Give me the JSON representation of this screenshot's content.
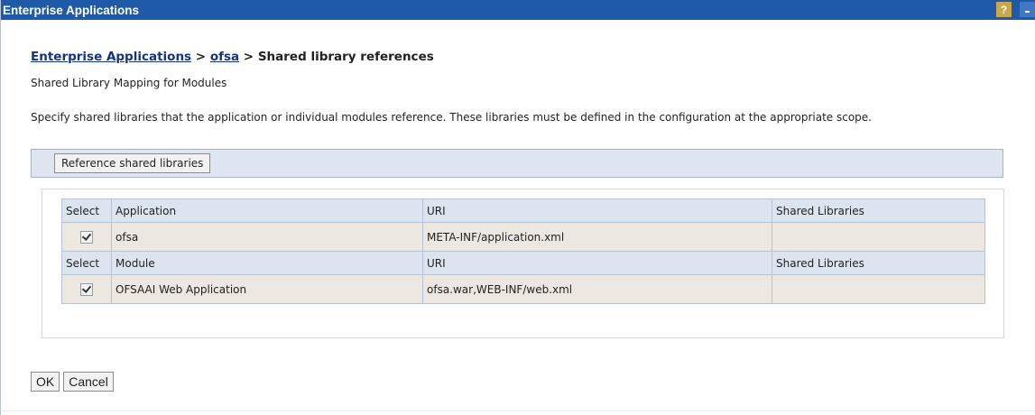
{
  "window": {
    "title": "Enterprise Applications",
    "help_glyph": "?"
  },
  "breadcrumb": {
    "root": "Enterprise Applications",
    "sep1": " > ",
    "app": "ofsa",
    "sep2": " > ",
    "current": "Shared library references"
  },
  "subtitle": "Shared Library Mapping for Modules",
  "description": "Specify shared libraries that the application or individual modules reference. These libraries must be defined in the configuration at the appropriate scope.",
  "reference_button": "Reference shared libraries",
  "table": {
    "app_header": {
      "select": "Select",
      "name": "Application",
      "uri": "URI",
      "libs": "Shared Libraries"
    },
    "app_row": {
      "checked": true,
      "name": "ofsa",
      "uri": "META-INF/application.xml",
      "libs": ""
    },
    "module_header": {
      "select": "Select",
      "name": "Module",
      "uri": "URI",
      "libs": "Shared Libraries"
    },
    "module_row": {
      "checked": true,
      "name": "OFSAAI Web Application",
      "uri": "ofsa.war,WEB-INF/web.xml",
      "libs": ""
    }
  },
  "actions": {
    "ok": "OK",
    "cancel": "Cancel"
  },
  "colors": {
    "titlebar": "#1f5aa8",
    "link": "#15328a",
    "header_bg": "#dce4ef",
    "row_bg": "#ece8e1"
  }
}
